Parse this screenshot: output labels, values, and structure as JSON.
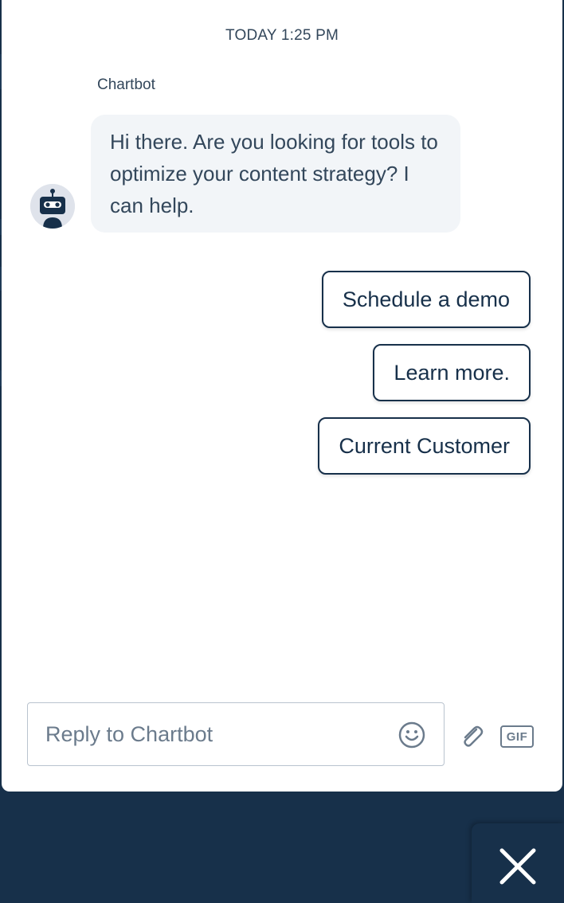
{
  "chat": {
    "timestamp": "TODAY 1:25 PM",
    "sender_name": "Chartbot",
    "message": "Hi there. Are you looking for tools to optimize your content strategy? I can help."
  },
  "quick_replies": [
    {
      "label": "Schedule a demo"
    },
    {
      "label": "Learn more."
    },
    {
      "label": "Current Customer"
    }
  ],
  "composer": {
    "placeholder": "Reply to Chartbot",
    "value": "",
    "gif_label": "GIF"
  },
  "icons": {
    "avatar": "robot-avatar-icon",
    "emoji": "smiley-icon",
    "attach": "paperclip-icon",
    "gif": "gif-icon",
    "close": "close-icon"
  },
  "colors": {
    "brand_navy": "#17304a",
    "bubble_bg": "#f2f5f8",
    "text": "#33475b"
  }
}
